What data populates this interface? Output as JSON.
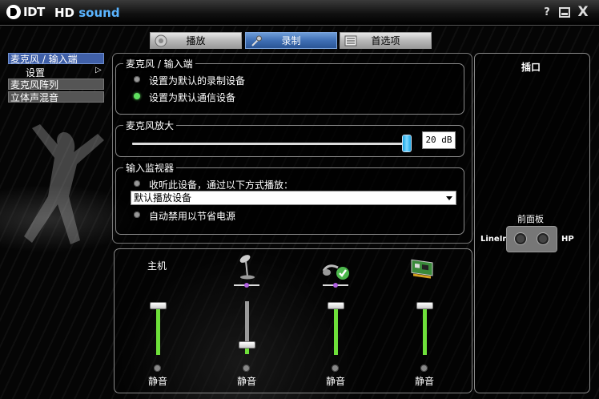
{
  "titlebar": {
    "logo": "IDT",
    "title_hd": "HD",
    "title_sound": "sound",
    "help": "?",
    "close": "X"
  },
  "tabs": [
    {
      "label": "播放",
      "icon": "speaker-icon",
      "active": false
    },
    {
      "label": "录制",
      "icon": "microphone-icon",
      "active": true
    },
    {
      "label": "首选项",
      "icon": "list-icon",
      "active": false
    }
  ],
  "sidebar": {
    "items": [
      {
        "label": "麦克风 / 输入端",
        "active": true
      },
      {
        "label": "麦克风阵列",
        "active": false
      },
      {
        "label": "立体声混音",
        "active": false
      }
    ],
    "sub_item": "设置",
    "sub_arrow": "▷"
  },
  "mic_input": {
    "title": "麦克风 / 输入端",
    "options": [
      {
        "label": "设置为默认的录制设备",
        "selected": false
      },
      {
        "label": "设置为默认通信设备",
        "selected": true
      }
    ]
  },
  "mic_boost": {
    "title": "麦克风放大",
    "value_label": "20 dB",
    "level_fraction": 1.0
  },
  "input_monitor": {
    "title": "输入监视器",
    "listen_label": "收听此设备，通过以下方式播放：",
    "playback_device": "默认播放设备",
    "auto_disable_label": "自动禁用以节省电源"
  },
  "mixer": {
    "master_label": "主机",
    "channels": [
      {
        "name": "master",
        "icon": null,
        "level_fraction": 1.0,
        "mute_label": "静音"
      },
      {
        "name": "microphone",
        "icon": "microphone-stand-icon",
        "level_fraction": 0.0,
        "mute_label": "静音"
      },
      {
        "name": "headset",
        "icon": "headset-check-icon",
        "level_fraction": 1.0,
        "mute_label": "静音"
      },
      {
        "name": "sound-card",
        "icon": "sound-card-icon",
        "level_fraction": 1.0,
        "mute_label": "静音"
      }
    ]
  },
  "jack_panel": {
    "title": "插口",
    "front_label": "前面板",
    "left_port": "LineIn",
    "right_port": "HP"
  },
  "colors": {
    "accent_tab": "#3f6fb4",
    "slider_green": "#6ee03a",
    "radio_on": "#5fe05f",
    "title_blue": "#5ab4ff"
  }
}
